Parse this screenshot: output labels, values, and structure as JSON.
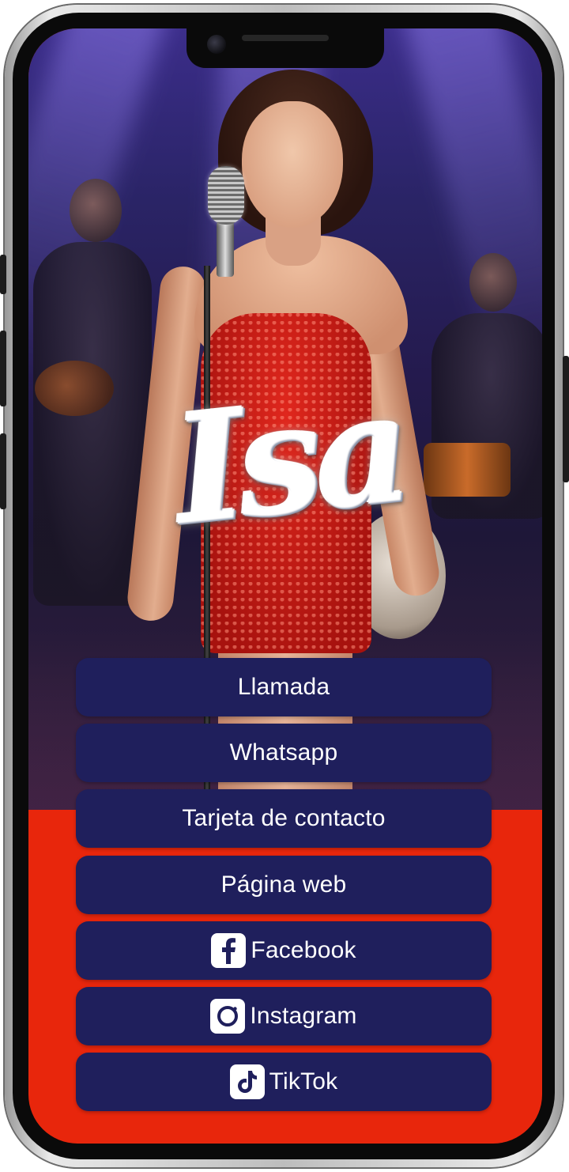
{
  "brand": {
    "logo_text": "Isa"
  },
  "colors": {
    "button_bg": "#1f1f5c",
    "button_text": "#ffffff",
    "screen_background": "#e8260c"
  },
  "links": [
    {
      "label": "Llamada",
      "icon": ""
    },
    {
      "label": "Whatsapp",
      "icon": ""
    },
    {
      "label": "Tarjeta de contacto",
      "icon": ""
    },
    {
      "label": "Página web",
      "icon": ""
    },
    {
      "label": "Facebook",
      "icon": "facebook-icon"
    },
    {
      "label": "Instagram",
      "icon": "instagram-icon"
    },
    {
      "label": "TikTok",
      "icon": "tiktok-icon"
    }
  ]
}
